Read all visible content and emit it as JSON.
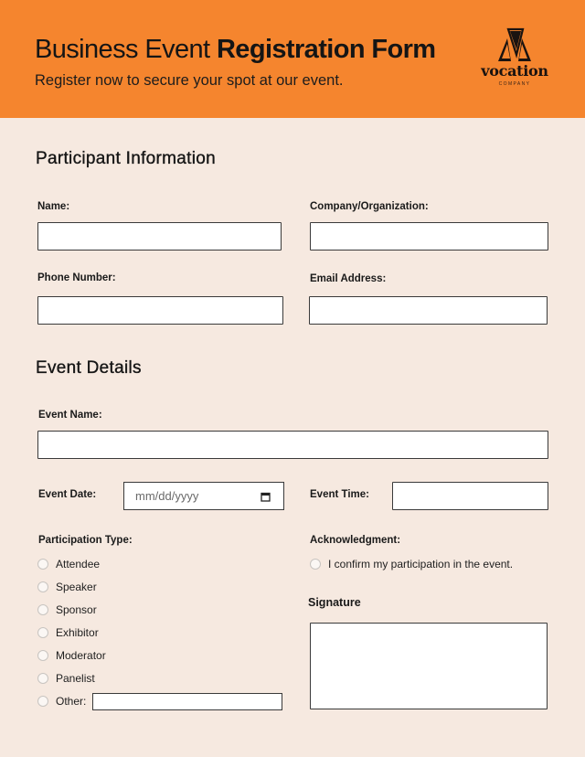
{
  "header": {
    "title_light": "Business Event ",
    "title_bold": "Registration Form",
    "subtitle": "Register now to secure your spot at our event.",
    "logo": {
      "icon": "vocation-logo-icon",
      "name": "vocation",
      "tagline": "COMPANY"
    },
    "colors": {
      "header_bg": "#f5852e",
      "page_bg": "#f6e9e0"
    }
  },
  "participant": {
    "title": "Participant Information",
    "name_label": "Name:",
    "company_label": "Company/Organization:",
    "phone_label": "Phone Number:",
    "email_label": "Email Address:",
    "name_value": "",
    "company_value": "",
    "phone_value": "",
    "email_value": ""
  },
  "event": {
    "title": "Event Details",
    "event_name_label": "Event Name:",
    "event_name_value": "",
    "event_date_label": "Event Date:",
    "event_date_placeholder": "mm/dd/yyyy",
    "event_time_label": "Event Time:",
    "event_time_value": ""
  },
  "participation": {
    "label": "Participation Type:",
    "options": [
      "Attendee",
      "Speaker",
      "Sponsor",
      "Exhibitor",
      "Moderator",
      "Panelist",
      "Other:"
    ],
    "selected": null,
    "other_value": ""
  },
  "acknowledgment": {
    "label": "Acknowledgment:",
    "option": "I confirm my participation in the event.",
    "checked": false
  },
  "signature": {
    "label": "Signature"
  }
}
